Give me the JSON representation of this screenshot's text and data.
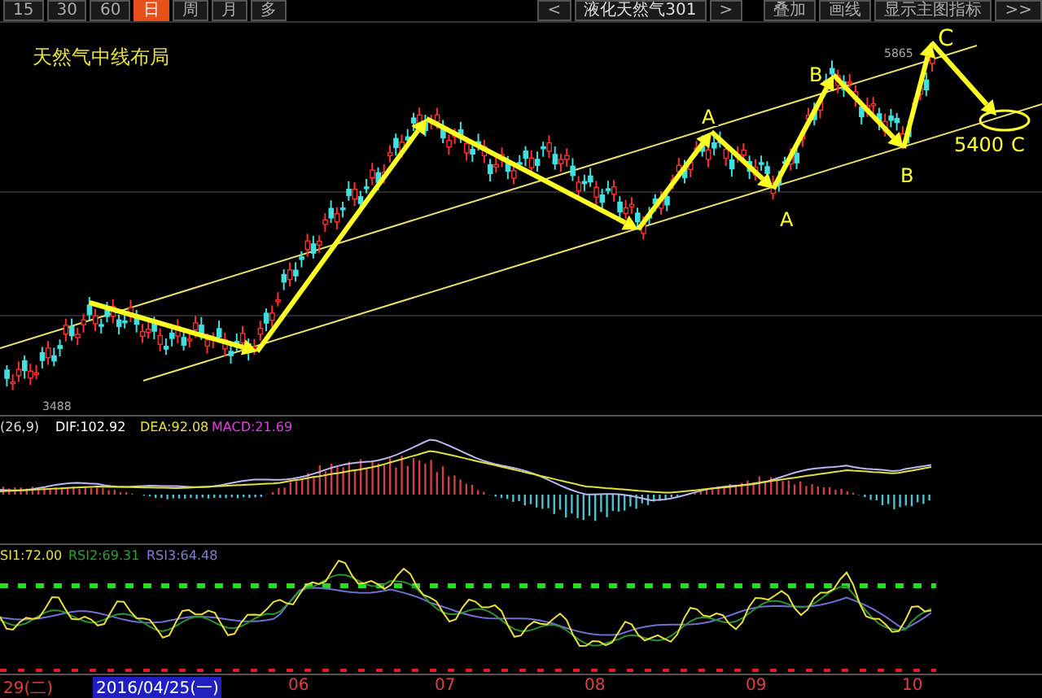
{
  "toolbar": {
    "periods": [
      {
        "label": "15",
        "selected": false
      },
      {
        "label": "30",
        "selected": false
      },
      {
        "label": "60",
        "selected": false
      },
      {
        "label": "日",
        "selected": true
      },
      {
        "label": "周",
        "selected": false
      },
      {
        "label": "月",
        "selected": false
      },
      {
        "label": "多",
        "selected": false
      }
    ],
    "prev": "<",
    "instrument": "液化天然气301",
    "next": ">",
    "tools": [
      "叠加",
      "画线",
      "显示主图指标",
      ">>"
    ]
  },
  "main_chart": {
    "title": "天然气中线布局",
    "high_label": "5865",
    "low_label": "3488",
    "annotations": [
      {
        "text": "A"
      },
      {
        "text": "A"
      },
      {
        "text": "B"
      },
      {
        "text": "B"
      },
      {
        "text": "C"
      },
      {
        "text": "5400"
      },
      {
        "text": "C"
      }
    ]
  },
  "macd_panel": {
    "params": "(26,9)",
    "dif": "DIF:102.92",
    "dea": "DEA:92.08",
    "macd": "MACD:21.69"
  },
  "rsi_panel": {
    "rsi1": "SI1:72.00",
    "rsi2": "RSI2:69.31",
    "rsi3": "RSI3:64.48"
  },
  "time_axis": [
    {
      "label": "29(二)",
      "selected": false
    },
    {
      "label": "2016/04/25(一)",
      "selected": true
    },
    {
      "label": "06",
      "selected": false
    },
    {
      "label": "07",
      "selected": false
    },
    {
      "label": "08",
      "selected": false
    },
    {
      "label": "09",
      "selected": false
    },
    {
      "label": "10",
      "selected": false
    }
  ]
}
